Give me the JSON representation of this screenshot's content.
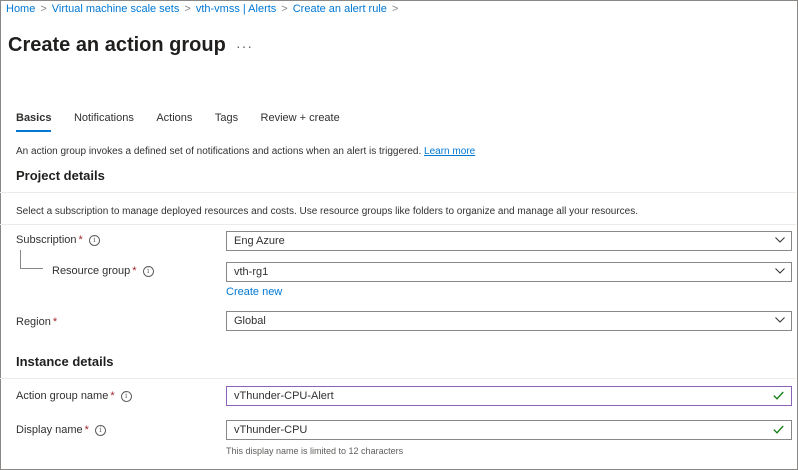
{
  "breadcrumb": {
    "items": [
      "Home",
      "Virtual machine scale sets",
      "vth-vmss | Alerts",
      "Create an alert rule"
    ],
    "separator": ">"
  },
  "page": {
    "title": "Create an action group",
    "more": "···"
  },
  "tabs": [
    "Basics",
    "Notifications",
    "Actions",
    "Tags",
    "Review + create"
  ],
  "active_tab": "Basics",
  "description": {
    "text": "An action group invokes a defined set of notifications and actions when an alert is triggered.",
    "link": "Learn more"
  },
  "project_details": {
    "heading": "Project details",
    "info": "Select a subscription to manage deployed resources and costs. Use resource groups like folders to organize and manage all your resources.",
    "subscription": {
      "label": "Subscription",
      "required": "*",
      "value": "Eng Azure"
    },
    "resource_group": {
      "label": "Resource group",
      "required": "*",
      "value": "vth-rg1",
      "create_new": "Create new"
    },
    "region": {
      "label": "Region",
      "required": "*",
      "value": "Global"
    }
  },
  "instance_details": {
    "heading": "Instance details",
    "action_group_name": {
      "label": "Action group name",
      "required": "*",
      "value": "vThunder-CPU-Alert"
    },
    "display_name": {
      "label": "Display name",
      "required": "*",
      "value": "vThunder-CPU",
      "hint": "This display name is limited to 12 characters"
    }
  },
  "colors": {
    "link": "#0078d4",
    "required": "#a4262c",
    "valid_check": "#107c10",
    "focus_border": "#8764b8"
  },
  "icons": {
    "info": "info-icon",
    "dropdown": "chevron-down-icon",
    "valid": "checkmark-icon"
  }
}
